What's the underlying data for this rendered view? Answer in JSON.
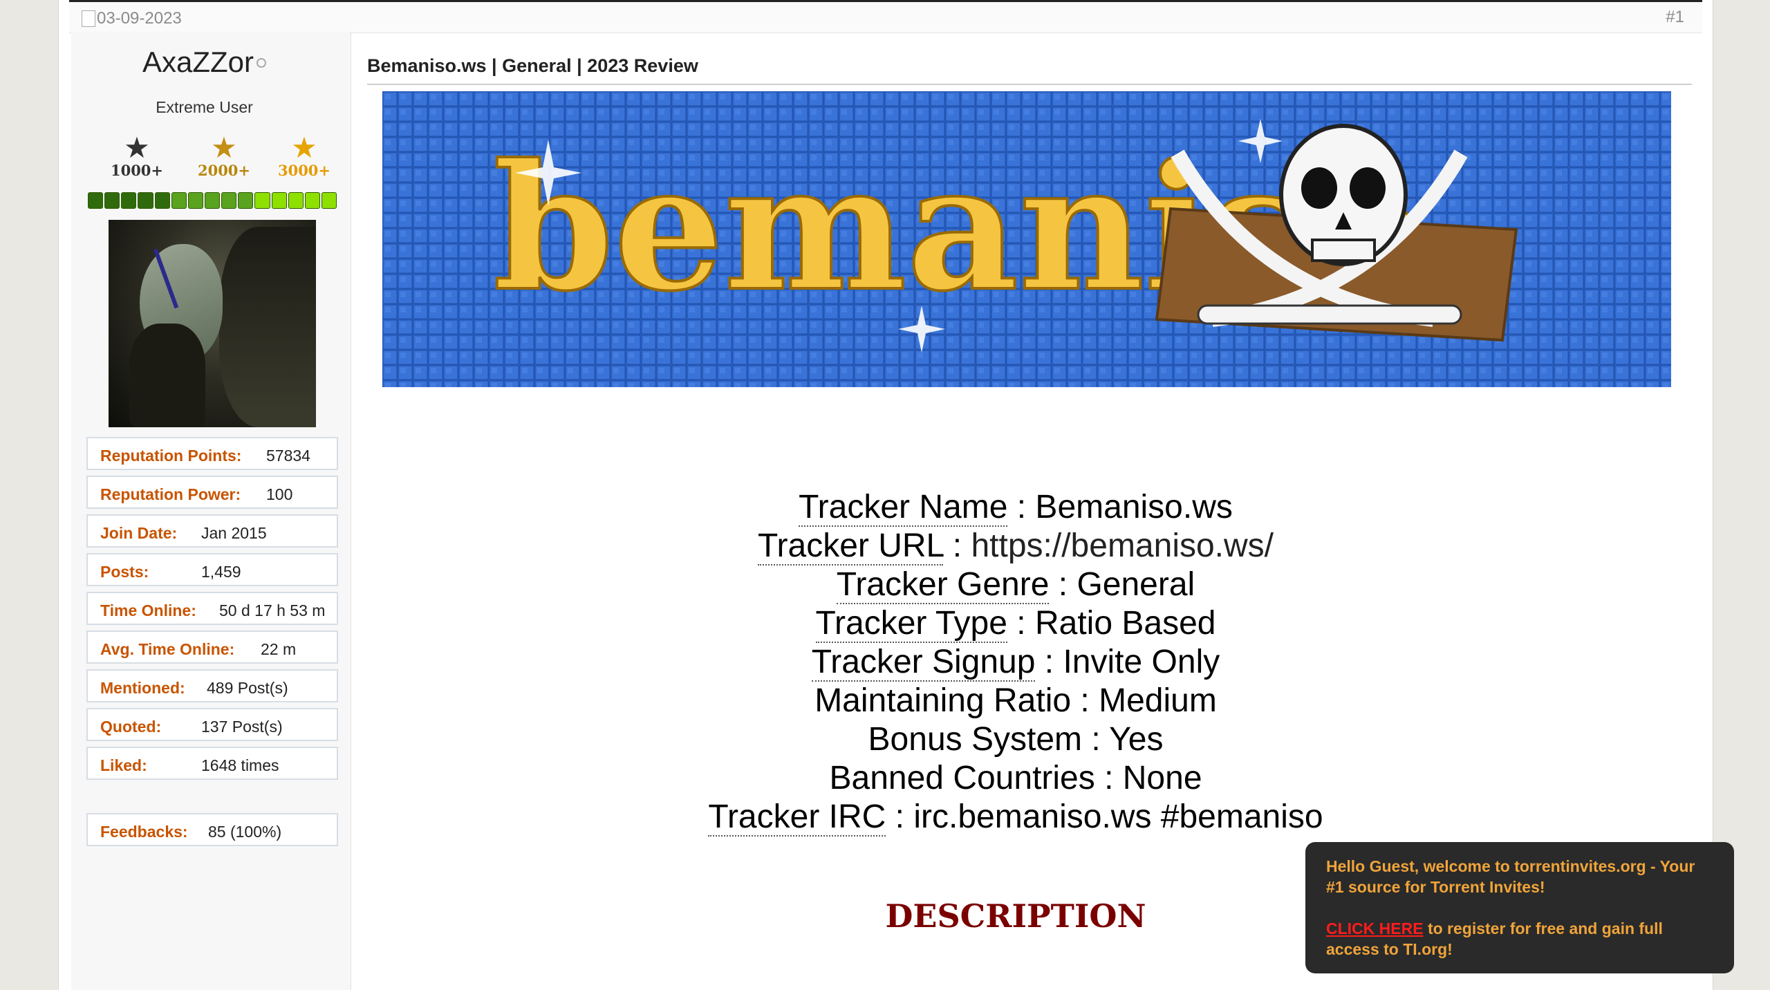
{
  "post": {
    "date": "03-09-2023",
    "number": "#1",
    "title": "Bemaniso.ws | General | 2023 Review"
  },
  "user": {
    "name": "AxaZZor",
    "title": "Extreme User",
    "ranks": [
      {
        "label": "1000+",
        "color": "#333333"
      },
      {
        "label": "2000+",
        "color": "#b8860b"
      },
      {
        "label": "3000+",
        "color": "#e69a00"
      }
    ],
    "reputation_bar": {
      "segments": 15,
      "dark_segments": 5
    },
    "stats": {
      "reputation_points": {
        "label": "Reputation Points:",
        "value": "57834"
      },
      "reputation_power": {
        "label": "Reputation Power:",
        "value": "100"
      },
      "join_date": {
        "label": "Join Date:",
        "value": "Jan 2015"
      },
      "posts": {
        "label": "Posts:",
        "value": "1,459"
      },
      "time_online": {
        "label": "Time Online:",
        "value": "50 d 17 h 53 m"
      },
      "avg_time_online": {
        "label": "Avg. Time Online:",
        "value": "22 m"
      },
      "mentioned": {
        "label": "Mentioned:",
        "value": "489 Post(s)"
      },
      "quoted": {
        "label": "Quoted:",
        "value": "137 Post(s)"
      },
      "liked": {
        "label": "Liked:",
        "value": "1648 times"
      },
      "feedbacks": {
        "label": "Feedbacks:",
        "value": "85 (100%)"
      }
    }
  },
  "banner": {
    "text": "bemaniso",
    "colors": {
      "background": "#2a5fc2",
      "letters": "#f5c542",
      "plank": "#8a5a2b"
    }
  },
  "tracker": {
    "name": {
      "label": "Tracker Name",
      "value": "Bemaniso.ws"
    },
    "url": {
      "label": "Tracker URL",
      "value": "https://bemaniso.ws/"
    },
    "genre": {
      "label": "Tracker Genre",
      "value": "General"
    },
    "type": {
      "label": "Tracker Type",
      "value": "Ratio Based"
    },
    "signup": {
      "label": "Tracker Signup",
      "value": "Invite Only"
    },
    "ratio": {
      "label": "Maintaining Ratio",
      "value": "Medium"
    },
    "bonus": {
      "label": "Bonus System",
      "value": "Yes"
    },
    "banned": {
      "label": "Banned Countries",
      "value": "None"
    },
    "irc": {
      "label": "Tracker IRC",
      "value": "irc.bemaniso.ws #bemaniso"
    }
  },
  "description_heading": "DESCRIPTION",
  "guest_popup": {
    "welcome": "Hello Guest, welcome to torrentinvites.org - Your #1 source for Torrent Invites!",
    "link": "CLICK HERE",
    "rest": " to register for free and gain full access to TI.org!"
  }
}
